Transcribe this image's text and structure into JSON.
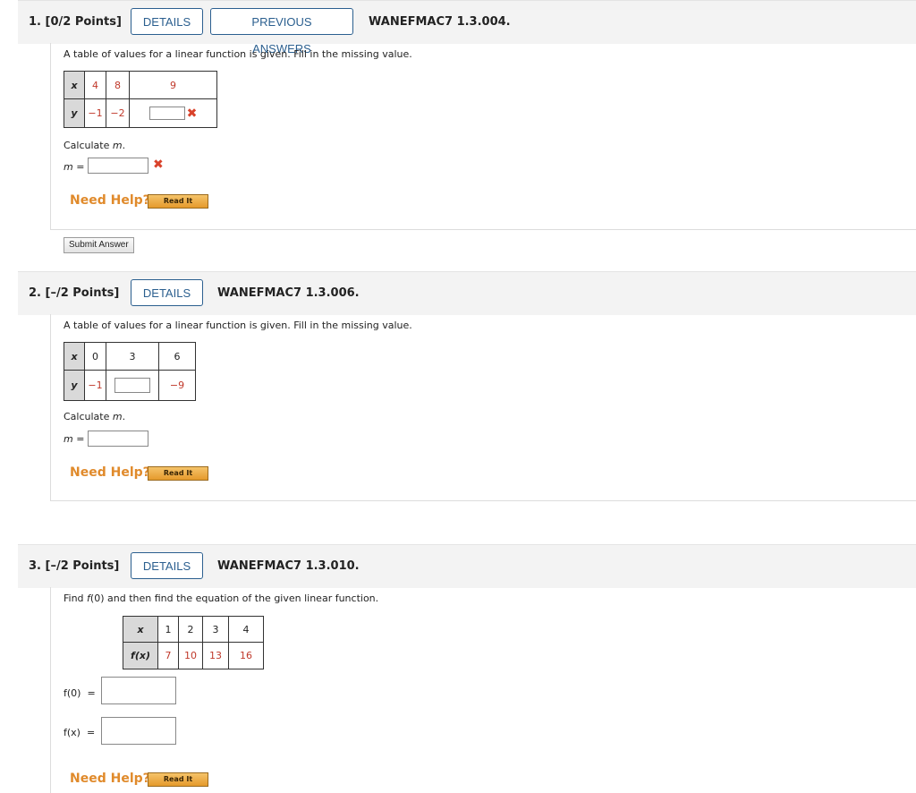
{
  "q1": {
    "number": "1.",
    "points": "[0/2 Points]",
    "details_label": "DETAILS",
    "prev_label": "PREVIOUS ANSWERS",
    "code": "WANEFMAC7 1.3.004.",
    "instruction": "A table of values for a linear function is given. Fill in the missing value.",
    "table": {
      "x_label": "x",
      "y_label": "y",
      "x": [
        "4",
        "8",
        "9"
      ],
      "y": [
        "−1",
        "−2",
        ""
      ]
    },
    "calc_label": "Calculate ",
    "calc_var": "m",
    "m_label": "m",
    "equals": " =",
    "need_help": "Need Help?",
    "read_it": "Read It",
    "submit": "Submit Answer"
  },
  "q2": {
    "number": "2.",
    "points": "[–/2 Points]",
    "details_label": "DETAILS",
    "code": "WANEFMAC7 1.3.006.",
    "instruction": "A table of values for a linear function is given. Fill in the missing value.",
    "table": {
      "x_label": "x",
      "y_label": "y",
      "x": [
        "0",
        "3",
        "6"
      ],
      "y": [
        "−1",
        "",
        "−9"
      ]
    },
    "calc_label": "Calculate ",
    "calc_var": "m",
    "m_label": "m",
    "equals": " =",
    "need_help": "Need Help?",
    "read_it": "Read It"
  },
  "q3": {
    "number": "3.",
    "points": "[–/2 Points]",
    "details_label": "DETAILS",
    "code": "WANEFMAC7 1.3.010.",
    "instruction_pre": "Find ",
    "instruction_f": "f",
    "instruction_post": "(0) and then find the equation of the given linear function.",
    "table": {
      "x_label": "x",
      "fx_label": "f(x)",
      "x": [
        "1",
        "2",
        "3",
        "4"
      ],
      "fx": [
        "7",
        "10",
        "13",
        "16"
      ]
    },
    "f0_label": "f(0)  =",
    "fx_input_label": "f(x)  =",
    "need_help": "Need Help?",
    "read_it": "Read It"
  },
  "colors": {
    "accent": "#2b5f8f",
    "help": "#e08a2b",
    "error": "#d9422b",
    "header_bg": "#f3f3f3"
  },
  "icons": {
    "incorrect": "x-mark-icon"
  }
}
